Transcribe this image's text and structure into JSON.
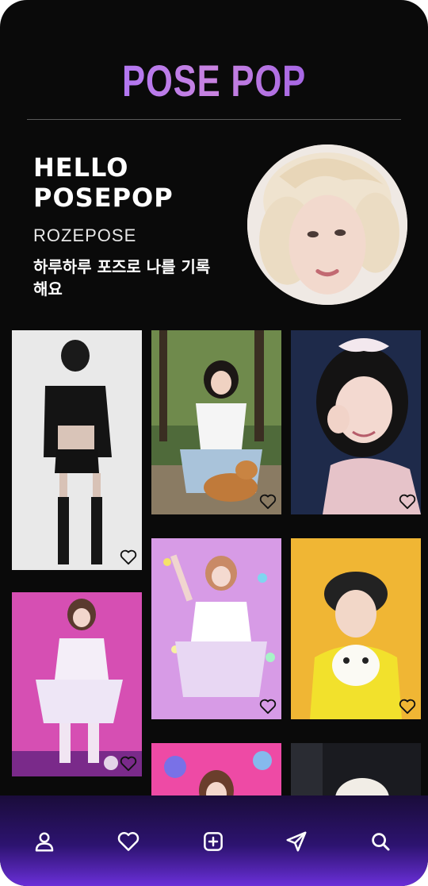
{
  "header": {
    "brand": "POSE POP"
  },
  "profile": {
    "greeting_line1": "HELLO",
    "greeting_line2": "POSEPOP",
    "handle": "ROZEPOSE",
    "tagline": "하루하루 포즈로 나를 기록해요"
  },
  "feed": {
    "cards": [
      {
        "id": "c1",
        "scene": "studio-black-outfit"
      },
      {
        "id": "c2",
        "scene": "forest-tiger"
      },
      {
        "id": "c3",
        "scene": "wink-portrait"
      },
      {
        "id": "c4",
        "scene": "pink-stage"
      },
      {
        "id": "c5",
        "scene": "pastel-stage"
      },
      {
        "id": "c6",
        "scene": "yellow-puppy"
      },
      {
        "id": "c7",
        "scene": "pink-lights"
      },
      {
        "id": "c8",
        "scene": "white-beanie"
      }
    ]
  },
  "bottom_nav": {
    "items": [
      {
        "name": "profile",
        "icon": "user-icon"
      },
      {
        "name": "likes",
        "icon": "heart-icon"
      },
      {
        "name": "add",
        "icon": "plus-square-icon"
      },
      {
        "name": "send",
        "icon": "send-icon"
      },
      {
        "name": "search",
        "icon": "search-icon"
      }
    ]
  },
  "colors": {
    "background": "#0a0a0a",
    "brand_gradient_start": "#a06cff",
    "brand_gradient_end": "#8a4fe8",
    "nav_gradient_end": "#6a2fd8"
  }
}
